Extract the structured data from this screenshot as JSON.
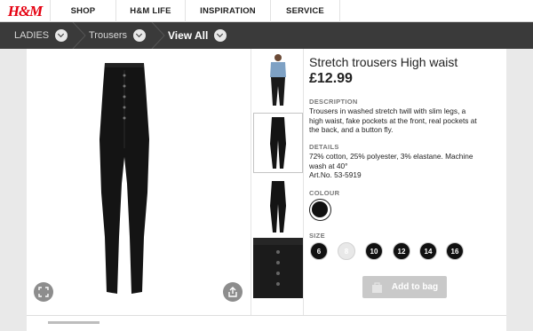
{
  "header": {
    "logo": "H&M",
    "nav": [
      "SHOP",
      "H&M LIFE",
      "INSPIRATION",
      "SERVICE"
    ]
  },
  "breadcrumb": {
    "items": [
      "LADIES",
      "Trousers",
      "View All"
    ]
  },
  "product": {
    "title": "Stretch trousers High waist",
    "price": "£12.99",
    "description_label": "DESCRIPTION",
    "description": "Trousers in washed stretch twill with slim legs, a high waist, fake pockets at the front, real pockets at the back, and a button fly.",
    "details_label": "DETAILS",
    "details": "72% cotton, 25% polyester, 3% elastane. Machine wash at 40°",
    "art_no": "Art.No. 53-5919",
    "colour_label": "COLOUR",
    "size_label": "SIZE",
    "sizes": [
      "6",
      "8",
      "10",
      "12",
      "14",
      "16"
    ],
    "add_to_bag": "Add to bag"
  },
  "icons": {
    "expand": "expand-icon",
    "share": "share-icon",
    "bag": "bag-icon",
    "chevron": "chevron-down-icon"
  },
  "colors": {
    "brand_red": "#e50010",
    "breadcrumb_bg": "#3a3a3a",
    "button_disabled": "#c9c9c9"
  }
}
